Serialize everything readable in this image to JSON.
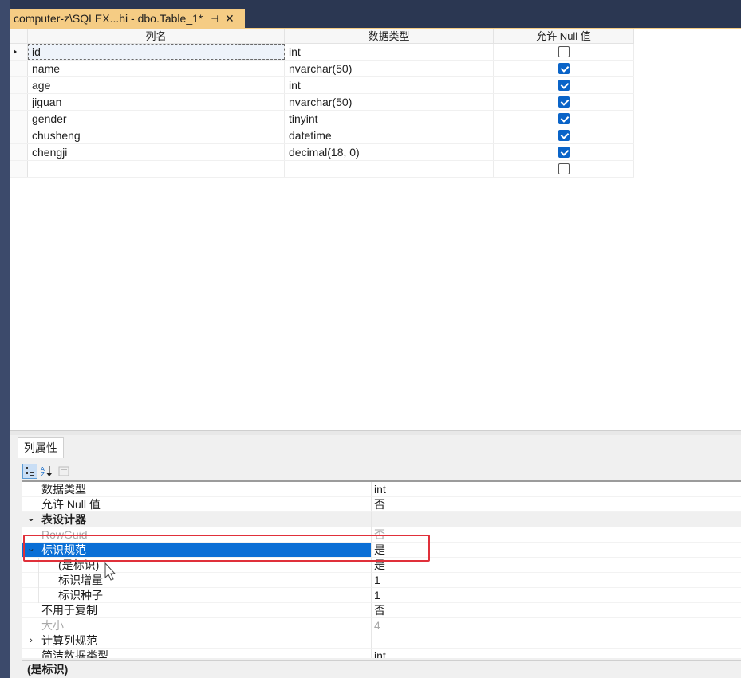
{
  "tab": {
    "title": "computer-z\\SQLEX...hi - dbo.Table_1*",
    "pin_icon": "pin-icon",
    "close_icon": "close-icon"
  },
  "grid": {
    "headers": [
      "列名",
      "数据类型",
      "允许 Null 值"
    ],
    "rows": [
      {
        "name": "id",
        "type": "int",
        "nullable": false
      },
      {
        "name": "name",
        "type": "nvarchar(50)",
        "nullable": true
      },
      {
        "name": "age",
        "type": "int",
        "nullable": true
      },
      {
        "name": "jiguan",
        "type": "nvarchar(50)",
        "nullable": true
      },
      {
        "name": "gender",
        "type": "tinyint",
        "nullable": true
      },
      {
        "name": "chusheng",
        "type": "datetime",
        "nullable": true
      },
      {
        "name": "chengji",
        "type": "decimal(18, 0)",
        "nullable": true
      },
      {
        "name": "",
        "type": "",
        "nullable": false
      }
    ]
  },
  "props": {
    "tab_label": "列属性",
    "rows": [
      {
        "name": "数据类型",
        "value": "int"
      },
      {
        "name": "允许 Null 值",
        "value": "否"
      },
      {
        "name": "表设计器",
        "value": ""
      },
      {
        "name": "RowGuid",
        "value": "否"
      },
      {
        "name": "标识规范",
        "value": "是"
      },
      {
        "name": "(是标识)",
        "value": "是"
      },
      {
        "name": "标识增量",
        "value": "1"
      },
      {
        "name": "标识种子",
        "value": "1"
      },
      {
        "name": "不用于复制",
        "value": "否"
      },
      {
        "name": "大小",
        "value": "4"
      },
      {
        "name": "计算列规范",
        "value": ""
      },
      {
        "name": "简洁数据类型",
        "value": "int"
      }
    ],
    "status_text": "(是标识)"
  },
  "colors": {
    "tab_bg": "#f5cc84",
    "selection": "#0a6fd6",
    "checkbox_on": "#0a64c8",
    "highlight_box": "#e0303a"
  }
}
